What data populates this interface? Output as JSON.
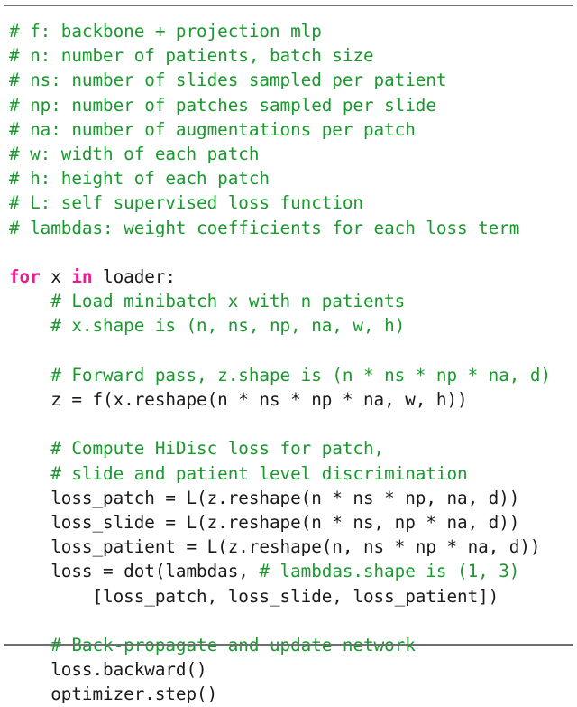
{
  "figure": {
    "kind": "algorithm-pseudocode-listing",
    "language": "python",
    "colors": {
      "background": "#ffffff",
      "comment": "#19992e",
      "keyword": "#ea1d8d",
      "code": "#1a1a1a",
      "rule": "#6e6e6e"
    }
  },
  "code": {
    "lines": [
      {
        "id": "l01",
        "indent": 0,
        "spans": [
          {
            "style": "cm",
            "text": "# f: backbone + projection mlp"
          }
        ]
      },
      {
        "id": "l02",
        "indent": 0,
        "spans": [
          {
            "style": "cm",
            "text": "# n: number of patients, batch size"
          }
        ]
      },
      {
        "id": "l03",
        "indent": 0,
        "spans": [
          {
            "style": "cm",
            "text": "# ns: number of slides sampled per patient"
          }
        ]
      },
      {
        "id": "l04",
        "indent": 0,
        "spans": [
          {
            "style": "cm",
            "text": "# np: number of patches sampled per slide"
          }
        ]
      },
      {
        "id": "l05",
        "indent": 0,
        "spans": [
          {
            "style": "cm",
            "text": "# na: number of augmentations per patch"
          }
        ]
      },
      {
        "id": "l06",
        "indent": 0,
        "spans": [
          {
            "style": "cm",
            "text": "# w: width of each patch"
          }
        ]
      },
      {
        "id": "l07",
        "indent": 0,
        "spans": [
          {
            "style": "cm",
            "text": "# h: height of each patch"
          }
        ]
      },
      {
        "id": "l08",
        "indent": 0,
        "spans": [
          {
            "style": "cm",
            "text": "# L: self supervised loss function"
          }
        ]
      },
      {
        "id": "l09",
        "indent": 0,
        "spans": [
          {
            "style": "cm",
            "text": "# lambdas: weight coefficients for each loss term"
          }
        ]
      },
      {
        "id": "l10",
        "indent": 0,
        "spans": []
      },
      {
        "id": "l11",
        "indent": 0,
        "spans": [
          {
            "style": "kw",
            "text": "for"
          },
          {
            "style": "txt",
            "text": " x "
          },
          {
            "style": "kw",
            "text": "in"
          },
          {
            "style": "txt",
            "text": " loader:"
          }
        ]
      },
      {
        "id": "l12",
        "indent": 4,
        "spans": [
          {
            "style": "cm",
            "text": "# Load minibatch x with n patients"
          }
        ]
      },
      {
        "id": "l13",
        "indent": 4,
        "spans": [
          {
            "style": "cm",
            "text": "# x.shape is (n, ns, np, na, w, h)"
          }
        ]
      },
      {
        "id": "l14",
        "indent": 0,
        "spans": []
      },
      {
        "id": "l15",
        "indent": 4,
        "spans": [
          {
            "style": "cm",
            "text": "# Forward pass, z.shape is (n * ns * np * na, d)"
          }
        ]
      },
      {
        "id": "l16",
        "indent": 4,
        "spans": [
          {
            "style": "txt",
            "text": "z = f(x.reshape(n * ns * np * na, w, h))"
          }
        ]
      },
      {
        "id": "l17",
        "indent": 0,
        "spans": []
      },
      {
        "id": "l18",
        "indent": 4,
        "spans": [
          {
            "style": "cm",
            "text": "# Compute HiDisc loss for patch,"
          }
        ]
      },
      {
        "id": "l19",
        "indent": 4,
        "spans": [
          {
            "style": "cm",
            "text": "# slide and patient level discrimination"
          }
        ]
      },
      {
        "id": "l20",
        "indent": 4,
        "spans": [
          {
            "style": "txt",
            "text": "loss_patch = L(z.reshape(n * ns * np, na, d))"
          }
        ]
      },
      {
        "id": "l21",
        "indent": 4,
        "spans": [
          {
            "style": "txt",
            "text": "loss_slide = L(z.reshape(n * ns, np * na, d))"
          }
        ]
      },
      {
        "id": "l22",
        "indent": 4,
        "spans": [
          {
            "style": "txt",
            "text": "loss_patient = L(z.reshape(n, ns * np * na, d))"
          }
        ]
      },
      {
        "id": "l23",
        "indent": 4,
        "spans": [
          {
            "style": "txt",
            "text": "loss = dot(lambdas, "
          },
          {
            "style": "cm",
            "text": "# lambdas.shape is (1, 3)"
          }
        ]
      },
      {
        "id": "l24",
        "indent": 8,
        "spans": [
          {
            "style": "txt",
            "text": "[loss_patch, loss_slide, loss_patient])"
          }
        ]
      },
      {
        "id": "l25",
        "indent": 0,
        "spans": []
      },
      {
        "id": "l26",
        "indent": 4,
        "spans": [
          {
            "style": "cm",
            "text": "# Back-propagate and update network"
          }
        ]
      },
      {
        "id": "l27",
        "indent": 4,
        "spans": [
          {
            "style": "txt",
            "text": "loss.backward()"
          }
        ]
      },
      {
        "id": "l28",
        "indent": 4,
        "spans": [
          {
            "style": "txt",
            "text": "optimizer.step()"
          }
        ]
      }
    ]
  }
}
